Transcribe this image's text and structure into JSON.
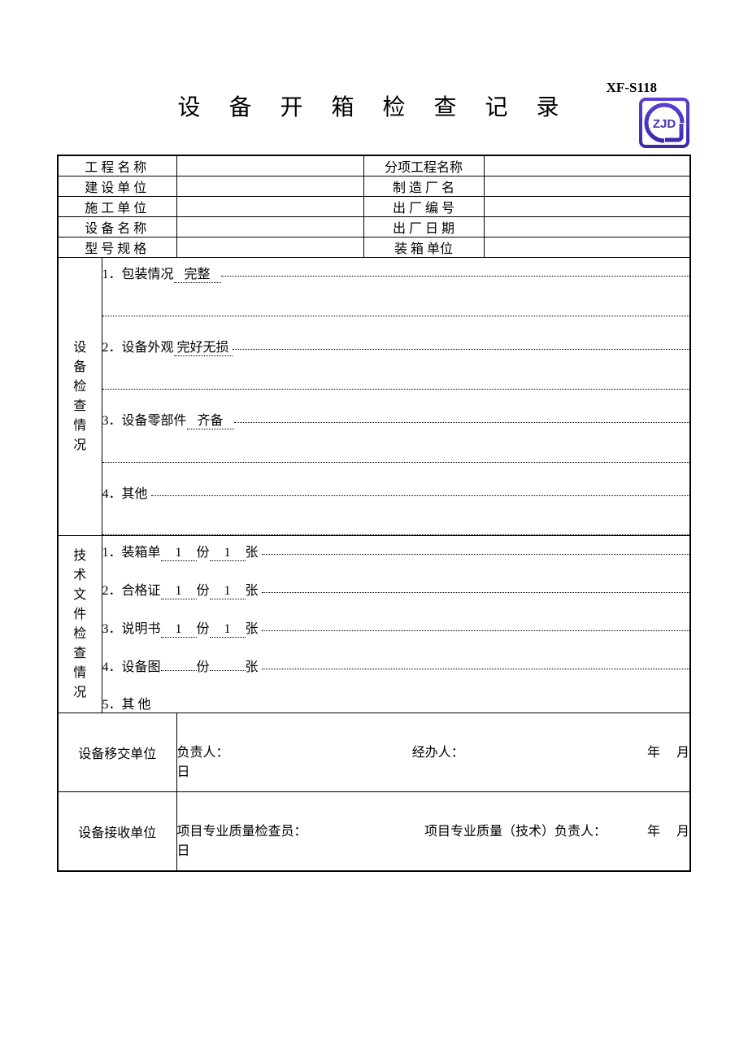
{
  "form_code": "XF-S118",
  "logo_text": "ZJD",
  "title": "设 备 开 箱 检 查 记 录",
  "header": {
    "row1_l": "工程名称",
    "row1_r": "分项工程名称",
    "row2_l": "建设单位",
    "row2_r": "制 造 厂 名",
    "row3_l": "施工单位",
    "row3_r": "出 厂 编 号",
    "row4_l": "设备名称",
    "row4_r": "出 厂 日 期",
    "row5_l": "型号规格",
    "row5_r": "装 箱 单位"
  },
  "equip_title": "设备检查情况",
  "equip": {
    "i1_pre": "1．包装情况",
    "i1_val": "完整",
    "i2_pre": "2．设备外观",
    "i2_val": "完好无损",
    "i3_pre": "3．设备零部件",
    "i3_val": "齐备",
    "i4_pre": "4．其他"
  },
  "tech_title": "技术文件检查情况",
  "tech": {
    "i1_pre": "1．装箱单",
    "i1_v1": "1",
    "i1_u1": "份",
    "i1_v2": "1",
    "i1_u2": "张",
    "i2_pre": "2．合格证",
    "i2_v1": "1",
    "i2_u1": "份",
    "i2_v2": "1",
    "i2_u2": "张",
    "i3_pre": "3．说明书",
    "i3_v1": "1",
    "i3_u1": "份",
    "i3_v2": "1",
    "i3_u2": "张",
    "i4_pre": "4．设备图",
    "i4_u1": "份",
    "i4_u2": "张",
    "i5_pre": "5．其  他"
  },
  "sig": {
    "row1_lbl": "设备移交单位",
    "row1": {
      "a": "负责人：",
      "b": "经办人：",
      "c": "年",
      "d": "月",
      "e": "日"
    },
    "row2_lbl": "设备接收单位",
    "row2": {
      "a": "项目专业质量检查员：",
      "b": "项目专业质量（技术）负责人：",
      "c": "年",
      "d": "月",
      "e": "日"
    }
  }
}
